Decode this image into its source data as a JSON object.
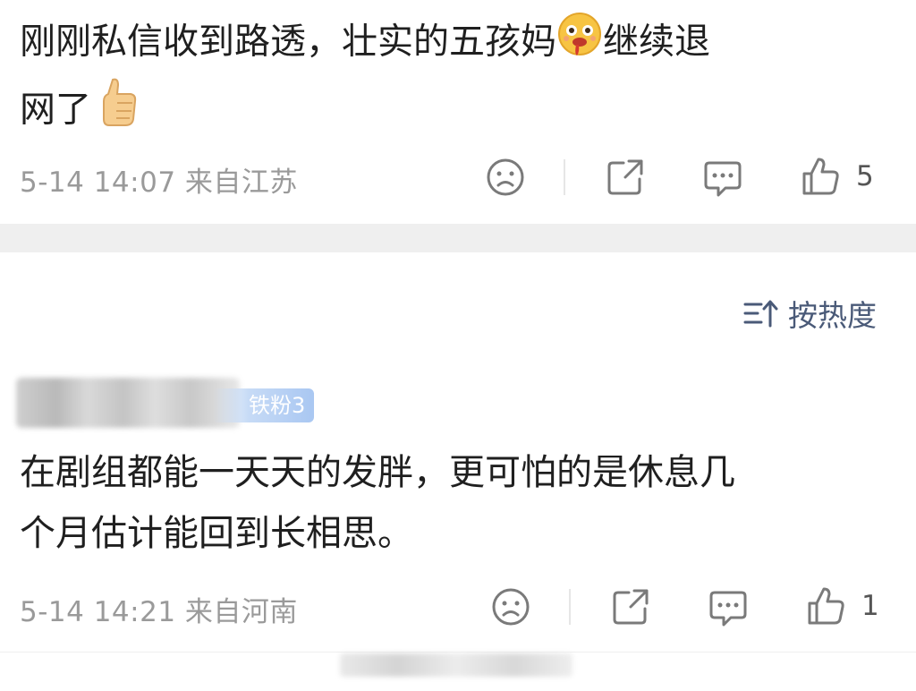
{
  "comment1": {
    "text_line1": "刚刚私信收到路透，壮实的五孩妈",
    "text_line1_end": "继续退",
    "text_line2": "网了",
    "meta": "5-14 14:07  来自江苏",
    "like_count": "5"
  },
  "sort": {
    "label": "按热度"
  },
  "comment2": {
    "fan_badge": "铁粉3",
    "text_line1": "在剧组都能一天天的发胖，更可怕的是休息几",
    "text_line2": "个月估计能回到长相思。",
    "meta": "5-14 14:21  来自河南",
    "like_count": "1"
  },
  "colors": {
    "text": "#1f1f1f",
    "meta": "#9a9a9a",
    "sort": "#4a5a78",
    "band": "#efefef",
    "icon": "#7a7a7a"
  },
  "icons": {
    "emoji_1": "drooling-face-emoji",
    "emoji_2": "thumbs-up-emoji",
    "action_1": "sad-face-icon",
    "action_2": "share-icon",
    "action_3": "comment-icon",
    "action_4": "like-icon",
    "sort": "sort-icon"
  }
}
